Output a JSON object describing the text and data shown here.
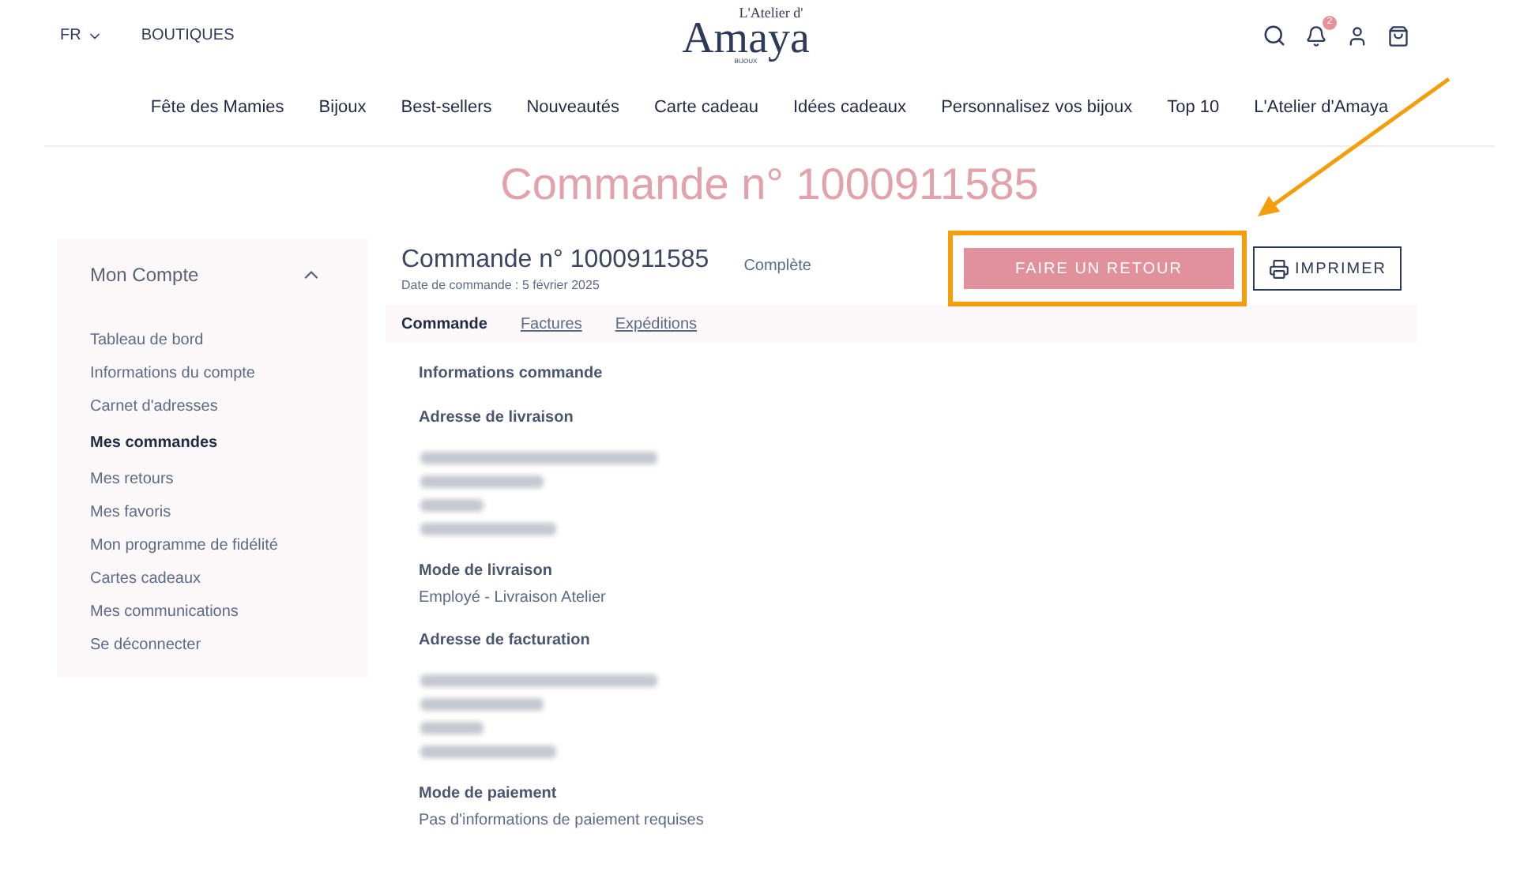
{
  "header": {
    "language": "FR",
    "boutiques": "BOUTIQUES",
    "logo": {
      "top": "L'Atelier d'",
      "main": "Amaya",
      "sub": "BIJOUX"
    },
    "notification_badge": "2"
  },
  "nav": [
    "Fête des Mamies",
    "Bijoux",
    "Best-sellers",
    "Nouveautés",
    "Carte cadeau",
    "Idées cadeaux",
    "Personnalisez vos bijoux",
    "Top 10",
    "L'Atelier d'Amaya"
  ],
  "page_title": "Commande n° 1000911585",
  "sidebar": {
    "title": "Mon Compte",
    "expanded": true,
    "items": [
      {
        "label": "Tableau de bord",
        "selected": false
      },
      {
        "label": "Informations du compte",
        "selected": false
      },
      {
        "label": "Carnet d'adresses",
        "selected": false
      },
      {
        "label": "Mes commandes",
        "selected": true
      },
      {
        "label": "Mes retours",
        "selected": false
      },
      {
        "label": "Mes favoris",
        "selected": false
      },
      {
        "label": "Mon programme de fidélité",
        "selected": false
      },
      {
        "label": "Cartes cadeaux",
        "selected": false
      },
      {
        "label": "Mes communications",
        "selected": false
      },
      {
        "label": "Se déconnecter",
        "selected": false
      }
    ]
  },
  "order": {
    "title": "Commande n° 1000911585",
    "date": "Date de commande : 5 février 2025",
    "status": "Complète",
    "return_button": "FAIRE UN RETOUR",
    "print_button": "IMPRIMER",
    "tabs": [
      {
        "label": "Commande",
        "selected": true
      },
      {
        "label": "Factures",
        "selected": false
      },
      {
        "label": "Expéditions",
        "selected": false
      }
    ],
    "heading": "Informations commande",
    "sections": [
      {
        "kind": "address",
        "title": "Adresse de livraison"
      },
      {
        "kind": "text",
        "title": "Mode de livraison",
        "value": "Employé - Livraison Atelier"
      },
      {
        "kind": "address",
        "title": "Adresse de facturation"
      },
      {
        "kind": "text",
        "title": "Mode de paiement",
        "value": "Pas d'informations de paiement requises"
      }
    ]
  }
}
